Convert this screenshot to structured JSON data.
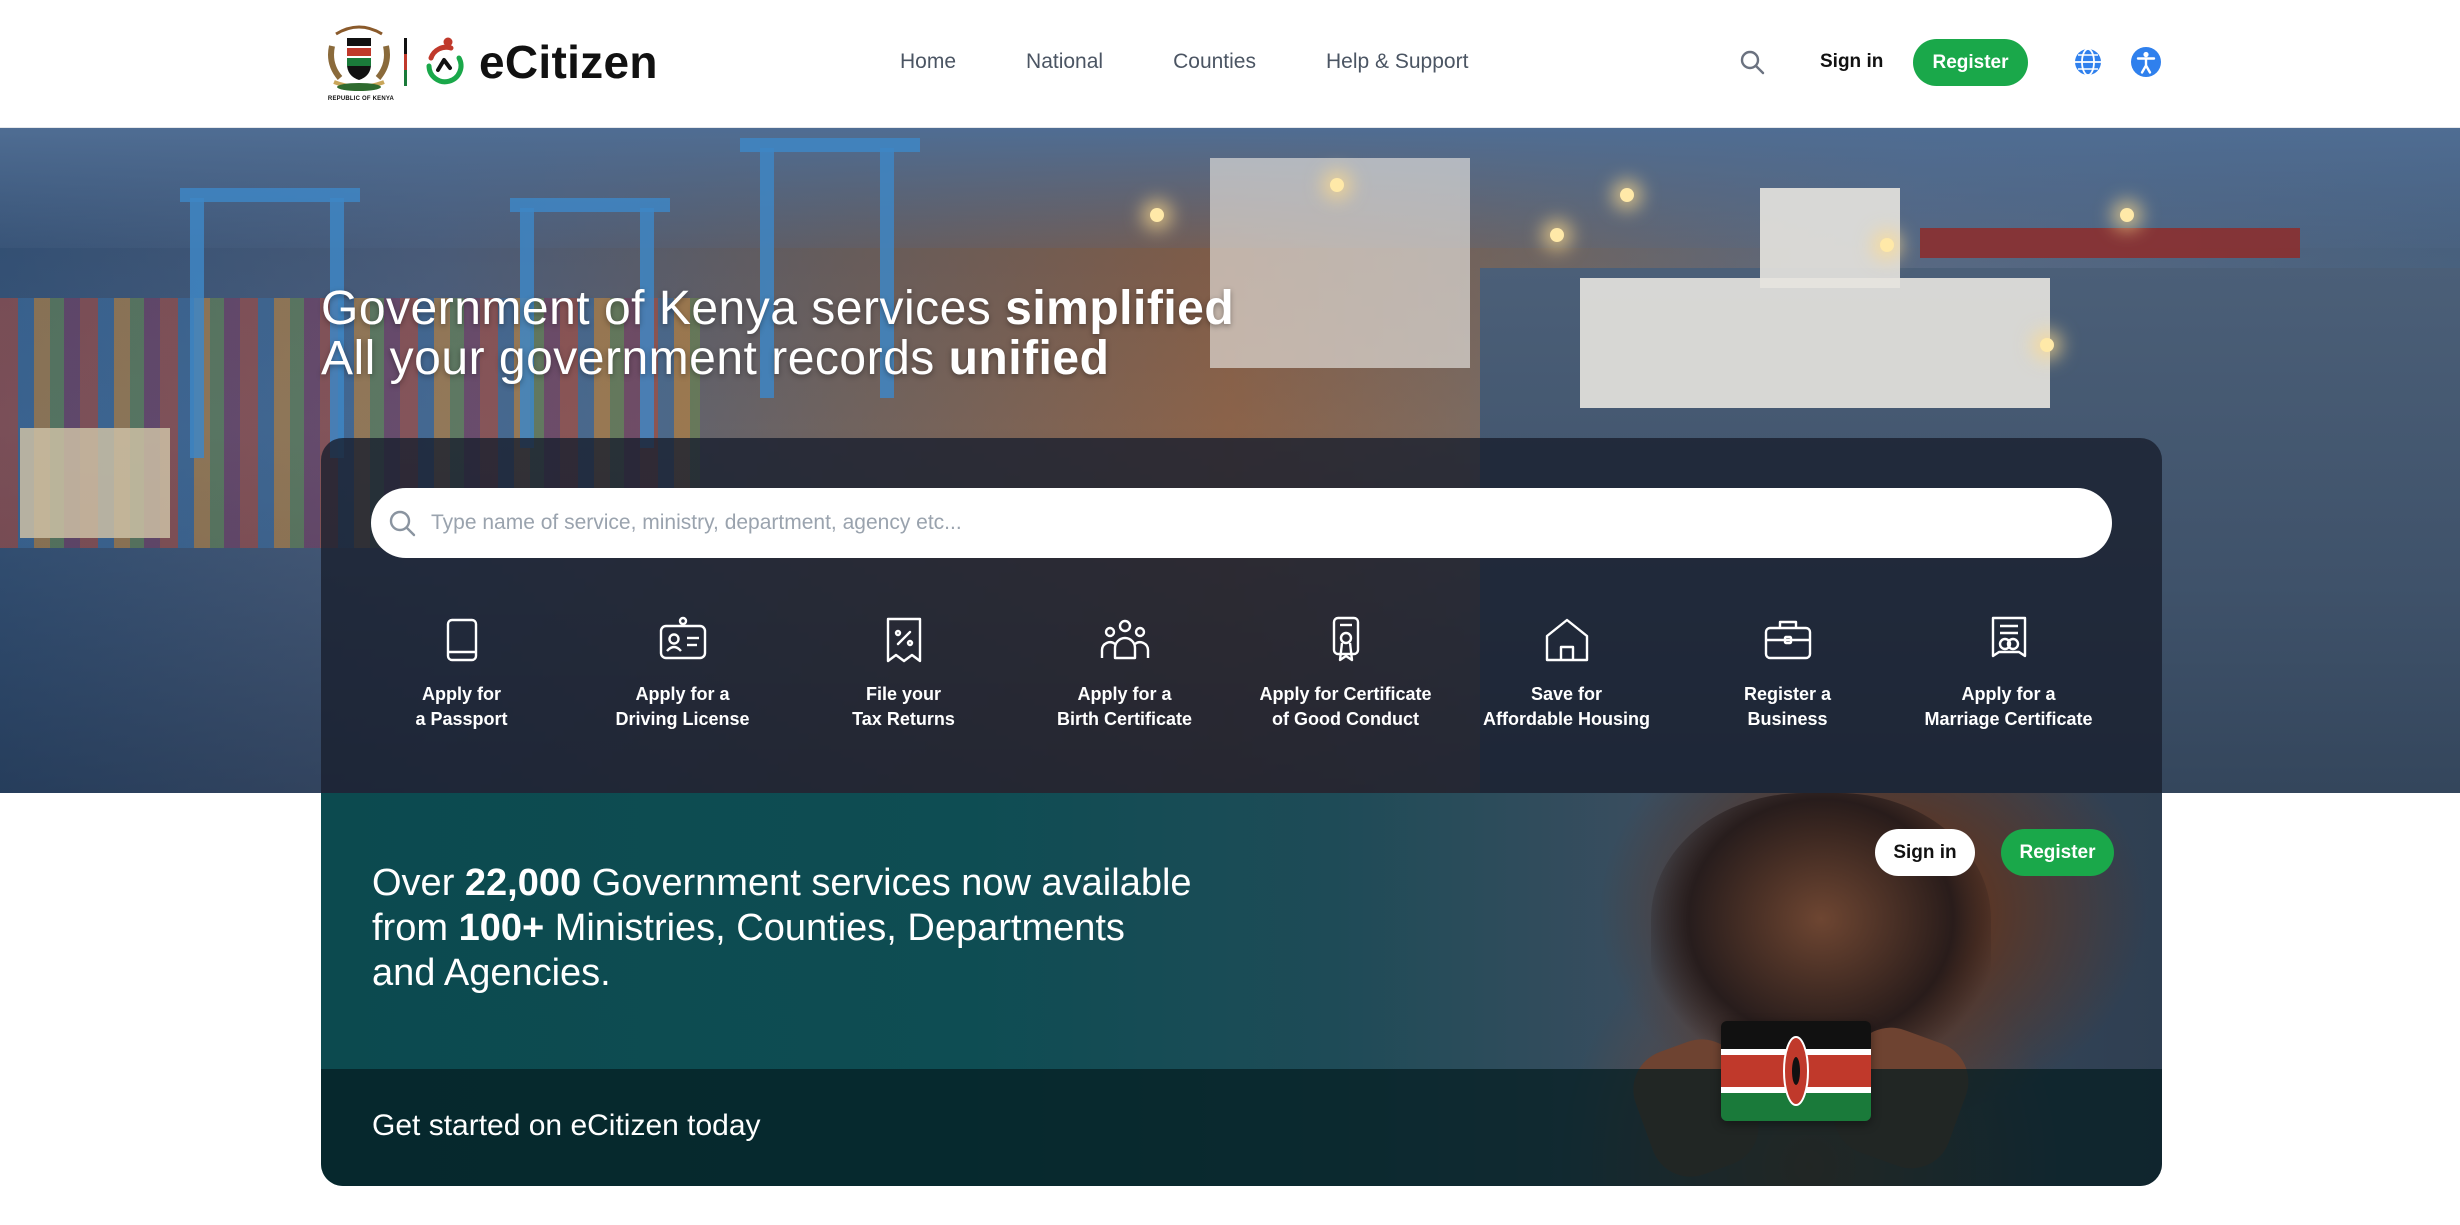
{
  "header": {
    "coat_of_arms_label": "REPUBLIC OF KENYA",
    "brand": "eCitizen",
    "nav": [
      "Home",
      "National",
      "Counties",
      "Help & Support"
    ],
    "sign_in": "Sign in",
    "register": "Register",
    "icons": [
      "search-icon",
      "globe-icon",
      "accessibility-icon"
    ]
  },
  "hero": {
    "line1_prefix": "Government of Kenya services ",
    "line1_bold": "simplified",
    "line2_prefix": "All your government records ",
    "line2_bold": "unified",
    "search_placeholder": "Type name of service, ministry, department, agency etc..."
  },
  "services": [
    {
      "line1": "Apply for",
      "line2": "a Passport",
      "icon": "passport-icon"
    },
    {
      "line1": "Apply for a",
      "line2": "Driving License",
      "icon": "id-card-icon"
    },
    {
      "line1": "File your",
      "line2": "Tax Returns",
      "icon": "tax-receipt-icon"
    },
    {
      "line1": "Apply for a",
      "line2": "Birth Certificate",
      "icon": "family-icon"
    },
    {
      "line1": "Apply for Certificate",
      "line2": "of Good Conduct",
      "icon": "certificate-badge-icon"
    },
    {
      "line1": "Save for",
      "line2": "Affordable Housing",
      "icon": "house-icon"
    },
    {
      "line1": "Register a",
      "line2": "Business",
      "icon": "briefcase-icon"
    },
    {
      "line1": "Apply for a",
      "line2": "Marriage Certificate",
      "icon": "marriage-certificate-icon"
    }
  ],
  "promo": {
    "p1": "Over ",
    "b1": "22,000",
    "p2": " Government services now available",
    "p3": "from ",
    "b2": "100+",
    "p4": " Ministries, Counties, Departments",
    "p5": "and Agencies.",
    "cta_text": "Get started on eCitizen today",
    "sign_in": "Sign in",
    "register": "Register"
  },
  "colors": {
    "accent_green": "#1aa84a",
    "accessibility_blue": "#2f80ed",
    "promo_teal": "#0c4a4f"
  }
}
